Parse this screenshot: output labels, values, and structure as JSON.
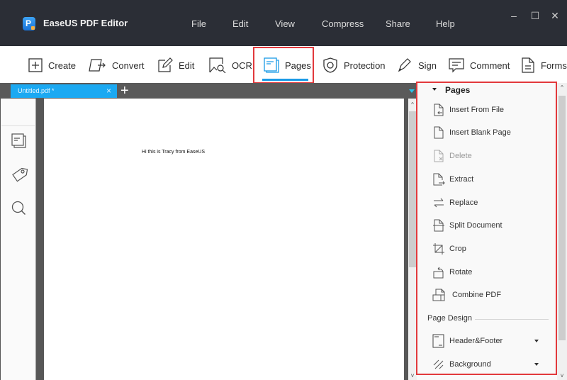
{
  "app": {
    "title": "EaseUS PDF Editor",
    "logo_letter": "P"
  },
  "menu": [
    "File",
    "Edit",
    "View",
    "Compress",
    "Share",
    "Help"
  ],
  "window_controls": {
    "minimize": "–",
    "maximize": "☐",
    "close": "✕"
  },
  "toolbar": {
    "items": [
      {
        "label": "Create",
        "icon": "plus-box-icon"
      },
      {
        "label": "Convert",
        "icon": "convert-icon"
      },
      {
        "label": "Edit",
        "icon": "edit-pencil-icon"
      },
      {
        "label": "OCR",
        "icon": "ocr-icon"
      },
      {
        "label": "Pages",
        "icon": "pages-icon",
        "active": true
      },
      {
        "label": "Protection",
        "icon": "shield-icon"
      },
      {
        "label": "Sign",
        "icon": "pen-icon"
      },
      {
        "label": "Comment",
        "icon": "comment-icon"
      },
      {
        "label": "Forms",
        "icon": "forms-icon"
      }
    ],
    "active_color": "#1a9ae6",
    "highlight_color": "#e2393c"
  },
  "tabs": {
    "items": [
      {
        "label": "Untitled.pdf *",
        "close": "×"
      }
    ],
    "new_tab": "+"
  },
  "leftbar": {
    "icons": [
      "thumbnails-icon",
      "bookmark-tag-icon",
      "search-icon"
    ]
  },
  "document": {
    "text": "Hi this is Tracy from EaseUS"
  },
  "scroll": {
    "up": "^",
    "down": "v"
  },
  "panel": {
    "header": "Pages",
    "items": [
      {
        "label": "Insert From File",
        "icon": "insert-from-file-icon",
        "enabled": true
      },
      {
        "label": "Insert Blank Page",
        "icon": "blank-page-icon",
        "enabled": true
      },
      {
        "label": "Delete",
        "icon": "delete-page-icon",
        "enabled": false
      },
      {
        "label": "Extract",
        "icon": "extract-icon",
        "enabled": true
      },
      {
        "label": "Replace",
        "icon": "replace-icon",
        "enabled": true
      },
      {
        "label": "Split Document",
        "icon": "split-icon",
        "enabled": true
      },
      {
        "label": "Crop",
        "icon": "crop-icon",
        "enabled": true
      },
      {
        "label": "Rotate",
        "icon": "rotate-icon",
        "enabled": true
      },
      {
        "label": "Combine PDF",
        "icon": "combine-icon",
        "enabled": true
      }
    ],
    "section_label": "Page Design",
    "design_items": [
      {
        "label": "Header&Footer",
        "icon": "header-footer-icon"
      },
      {
        "label": "Background",
        "icon": "background-icon"
      }
    ]
  }
}
